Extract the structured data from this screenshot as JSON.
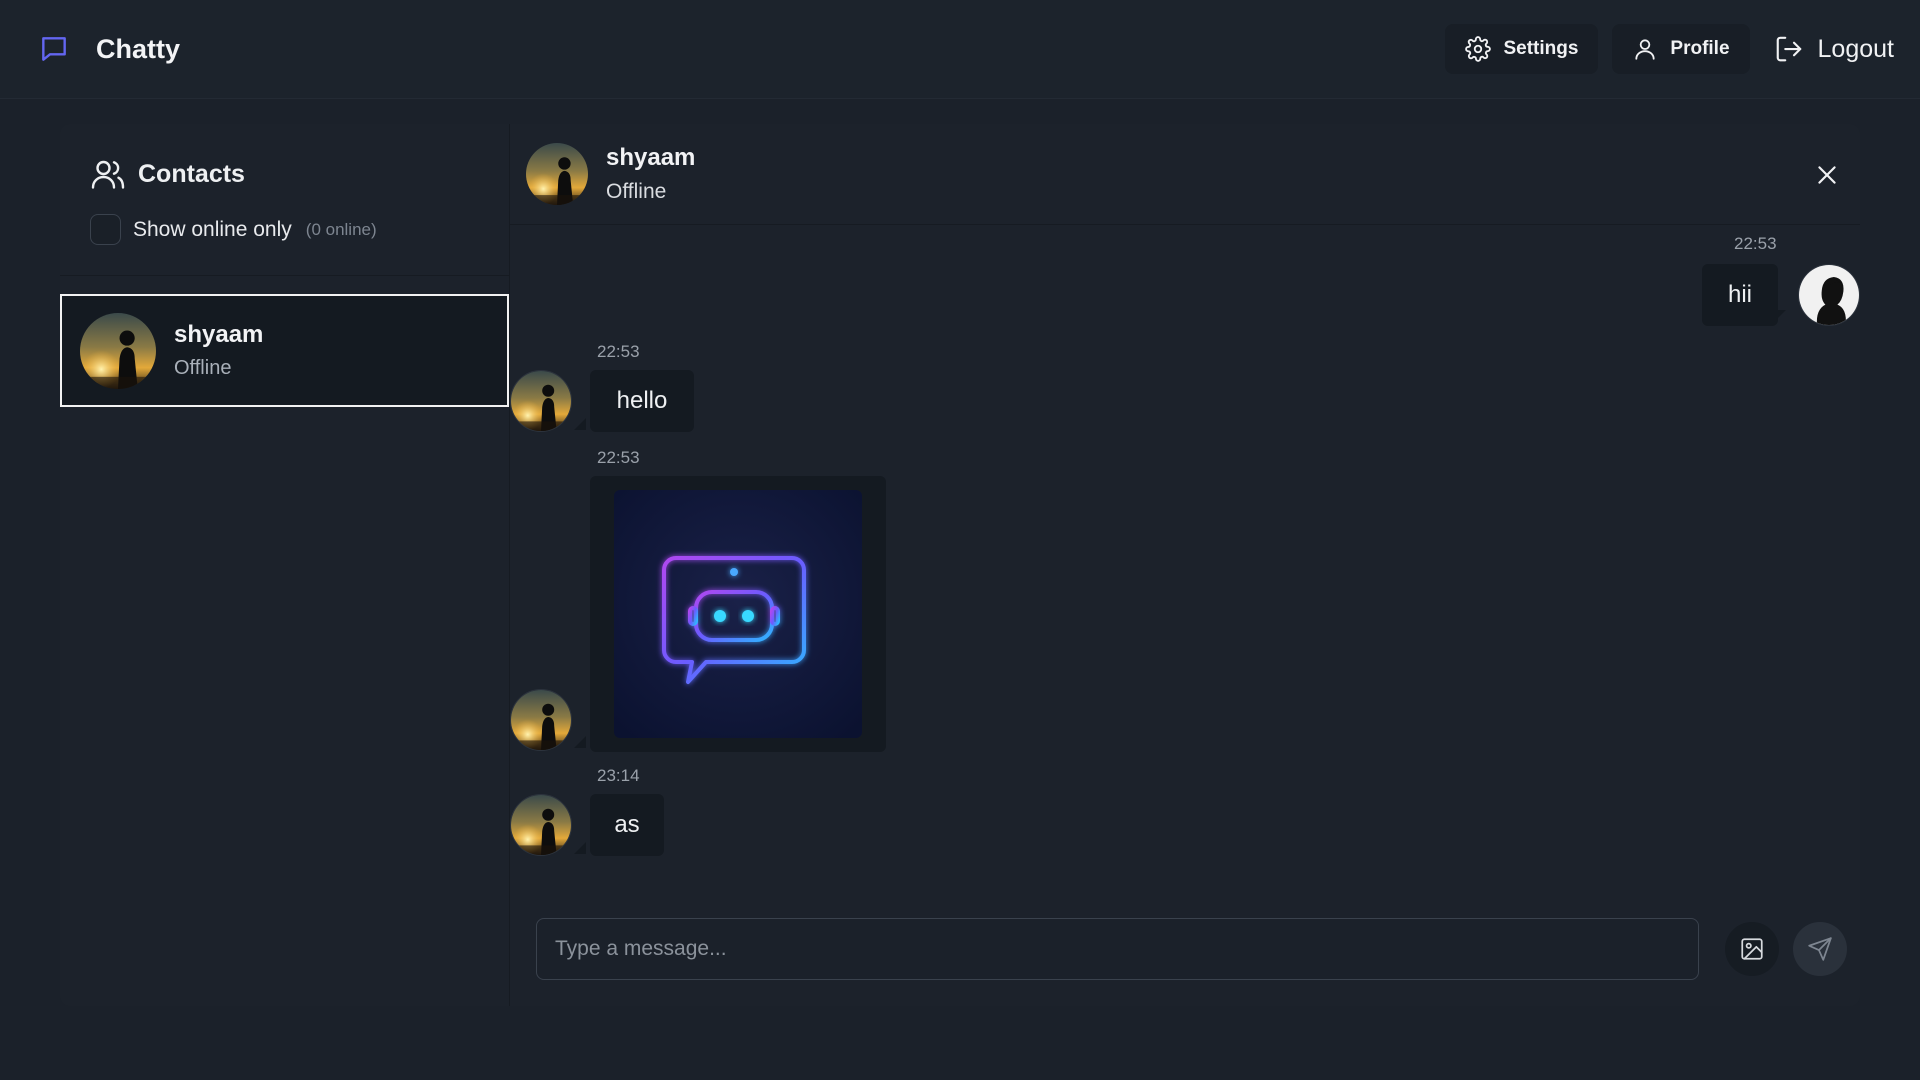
{
  "app": {
    "name": "Chatty"
  },
  "nav": {
    "settings_label": "Settings",
    "profile_label": "Profile",
    "logout_label": "Logout"
  },
  "sidebar": {
    "title": "Contacts",
    "filter_label": "Show online only",
    "online_count": "(0 online)",
    "contacts": [
      {
        "name": "shyaam",
        "status": "Offline"
      }
    ]
  },
  "chat": {
    "contact_name": "shyaam",
    "contact_status": "Offline",
    "messages": [
      {
        "from": "me",
        "time": "22:53",
        "text": "hii"
      },
      {
        "from": "them",
        "time": "22:53",
        "text": "hello"
      },
      {
        "from": "them",
        "time": "22:53",
        "image": "robot-chat-bubble"
      },
      {
        "from": "them",
        "time": "23:14",
        "text": "as"
      }
    ]
  },
  "composer": {
    "placeholder": "Type a message..."
  },
  "icons": {
    "logo": "chat-bubble-icon",
    "settings": "gear-icon",
    "profile": "user-icon",
    "logout": "logout-icon",
    "contacts": "users-icon",
    "close": "close-icon",
    "image": "image-icon",
    "send": "send-icon"
  },
  "colors": {
    "background": "#1b212a",
    "panel": "#1c222b",
    "bubble": "#141a21",
    "accent": "#6366f1",
    "selected_border": "#f2f2f2"
  }
}
